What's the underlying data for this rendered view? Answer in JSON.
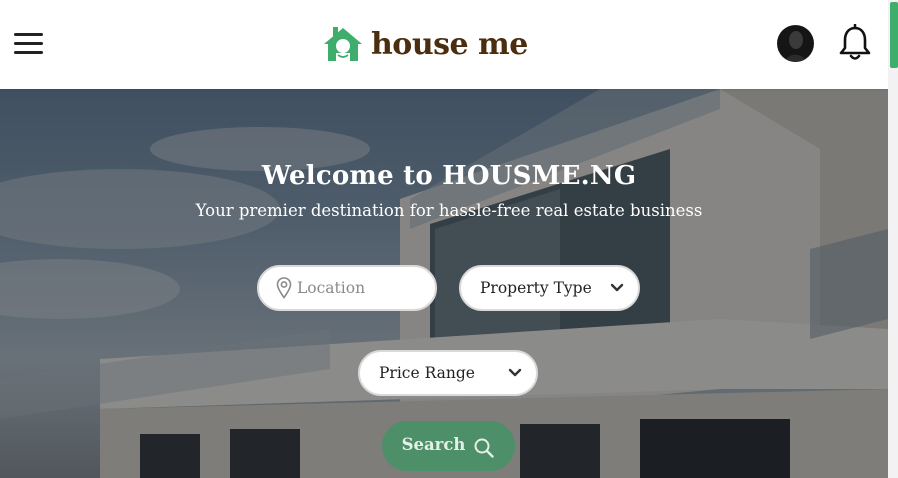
{
  "header": {
    "logo_text": "house me",
    "menu_icon": "hamburger-menu-icon",
    "logo_icon": "house-logo-icon",
    "notification_icon": "bell-icon",
    "accent_color": "#3fae6c",
    "logo_text_color": "#4a2e0f"
  },
  "hero": {
    "title": "Welcome to HOUSME.NG",
    "subtitle": "Your premier destination for hassle-free real estate business"
  },
  "search": {
    "location_placeholder": "Location",
    "location_value": "",
    "location_icon": "map-pin-icon",
    "property_type_label": "Property Type",
    "price_range_label": "Price Range",
    "dropdown_icon": "chevron-down-icon",
    "search_button_label": "Search",
    "search_icon": "magnifier-icon",
    "button_color": "#3a9662"
  }
}
